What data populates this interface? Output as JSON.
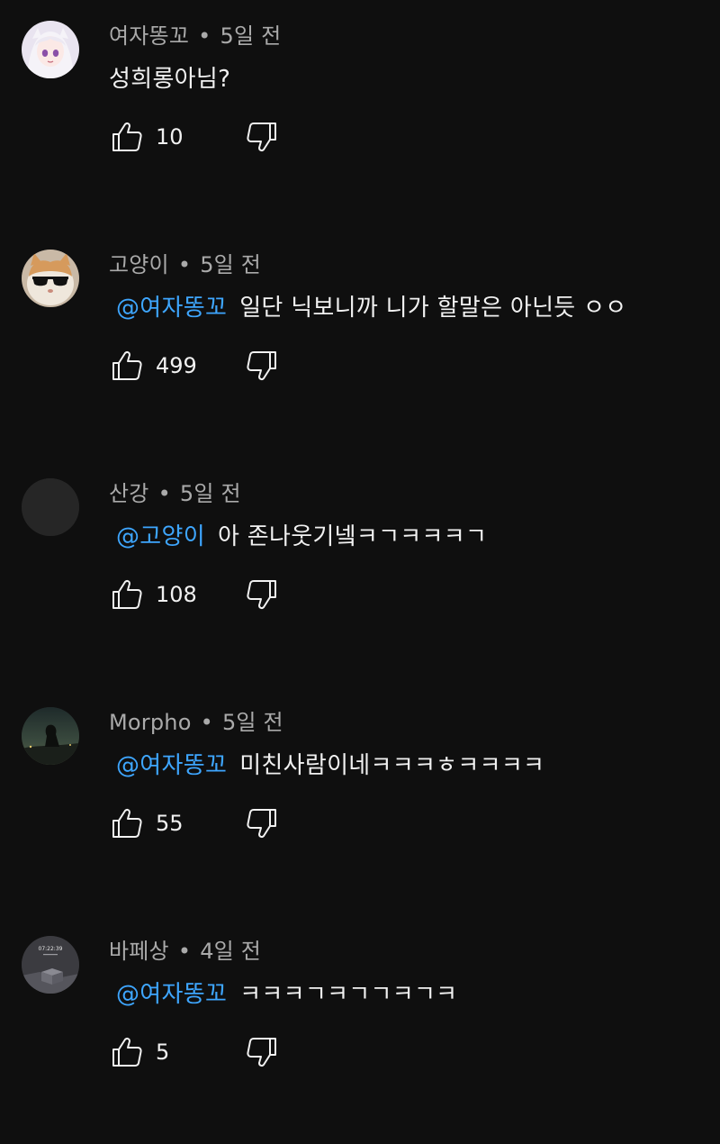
{
  "comments": [
    {
      "author": "여자똥꼬",
      "separator": "•",
      "time": "5일 전",
      "mention": "",
      "text": "성희롱아님?",
      "likes": "10",
      "avatar_icon": "anime-girl-avatar"
    },
    {
      "author": "고양이",
      "separator": "•",
      "time": "5일 전",
      "mention": "@여자똥꼬",
      "text": "일단 닉보니까 니가 할말은 아닌듯 ㅇㅇ",
      "likes": "499",
      "avatar_icon": "cat-sunglasses-avatar"
    },
    {
      "author": "산강",
      "separator": "•",
      "time": "5일 전",
      "mention": "@고양이",
      "text": "아 존나웃기넼ㅋㄱㅋㅋㅋㄱ",
      "likes": "108",
      "avatar_icon": "blank-avatar"
    },
    {
      "author": "Morpho",
      "separator": "•",
      "time": "5일 전",
      "mention": "@여자똥꼬",
      "text": "미친사람이네ㅋㅋㅋㅎㅋㅋㅋㅋ",
      "likes": "55",
      "avatar_icon": "night-sky-avatar"
    },
    {
      "author": "바페상",
      "separator": "•",
      "time": "4일 전",
      "mention": "@여자똥꼬",
      "text": "ㅋㅋㅋㄱㅋㄱㄱㅋㄱㅋ",
      "likes": "5",
      "avatar_icon": "clock-screen-avatar",
      "avatar_text": "07:22:39"
    }
  ],
  "colors": {
    "background": "#0f0f0f",
    "meta_text": "#aaaaaa",
    "body_text": "#f1f1f1",
    "mention": "#3ea6ff"
  }
}
